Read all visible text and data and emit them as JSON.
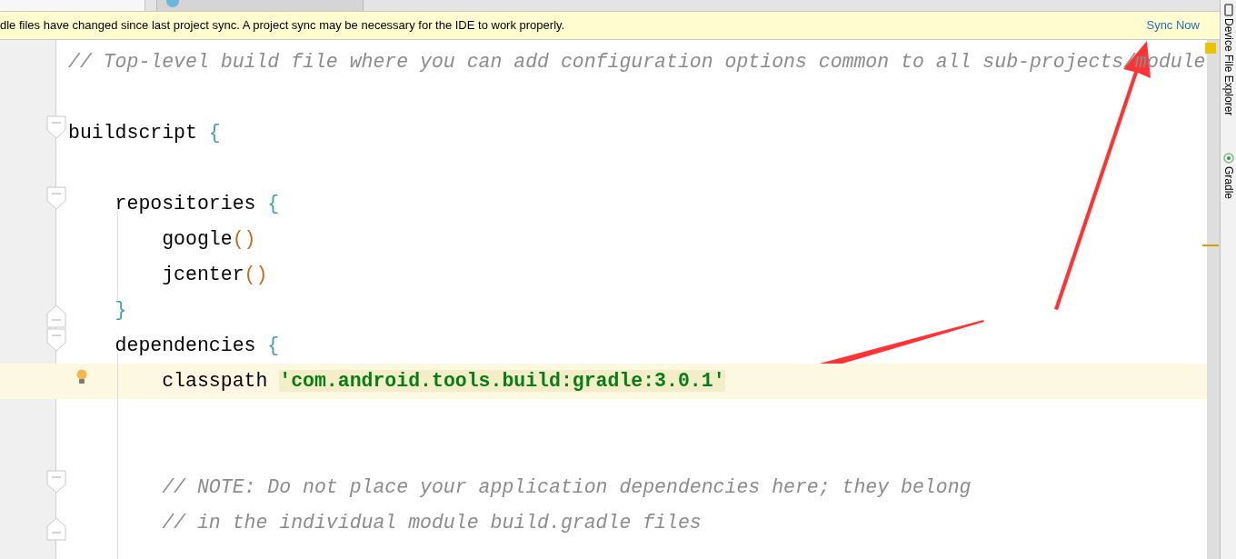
{
  "tabs": [
    {
      "selected": true
    },
    {
      "selected": false
    }
  ],
  "banner": {
    "message": "dle files have changed since last project sync. A project sync may be necessary for the IDE to work properly.",
    "action": "Sync Now"
  },
  "code_lines": [
    {
      "kind": "code",
      "tokens": [
        {
          "kind": "comment",
          "text": "// Top-level build file where you can add configuration options common to all sub-projects/module"
        }
      ]
    },
    {
      "kind": "blank"
    },
    {
      "kind": "code",
      "fold_start": true,
      "tokens": [
        {
          "kind": "plain",
          "text": "buildscript "
        },
        {
          "kind": "brace",
          "text": "{"
        }
      ]
    },
    {
      "kind": "blank"
    },
    {
      "kind": "code",
      "fold_start": true,
      "tokens": [
        {
          "kind": "plain",
          "text": "    repositories "
        },
        {
          "kind": "brace",
          "text": "{"
        }
      ]
    },
    {
      "kind": "code",
      "tokens": [
        {
          "kind": "plain",
          "text": "        google"
        },
        {
          "kind": "paren",
          "text": "()"
        }
      ]
    },
    {
      "kind": "code",
      "tokens": [
        {
          "kind": "plain",
          "text": "        jcenter"
        },
        {
          "kind": "paren",
          "text": "()"
        }
      ]
    },
    {
      "kind": "code",
      "fold_end": true,
      "tokens": [
        {
          "kind": "brace",
          "text": "    }"
        }
      ]
    },
    {
      "kind": "code",
      "fold_start": true,
      "tokens": [
        {
          "kind": "plain",
          "text": "    dependencies "
        },
        {
          "kind": "brace",
          "text": "{"
        }
      ]
    },
    {
      "kind": "code",
      "highlighted": true,
      "intention": true,
      "tokens": [
        {
          "kind": "plain",
          "text": "        classpath "
        },
        {
          "kind": "string",
          "text": "'com.android.tools.build:gradle:3.0.1'"
        }
      ]
    },
    {
      "kind": "blank"
    },
    {
      "kind": "blank"
    },
    {
      "kind": "code",
      "fold_start": true,
      "tokens": [
        {
          "kind": "comment",
          "text": "        // NOTE: Do not place your application dependencies here; they belong"
        }
      ]
    },
    {
      "kind": "code",
      "fold_end": true,
      "tokens": [
        {
          "kind": "comment",
          "text": "        // in the individual module build.gradle files"
        }
      ]
    }
  ],
  "side_tools": [
    {
      "kind": "device",
      "label": "Device File Explorer"
    },
    {
      "kind": "gradle",
      "label": "Gradle"
    }
  ]
}
